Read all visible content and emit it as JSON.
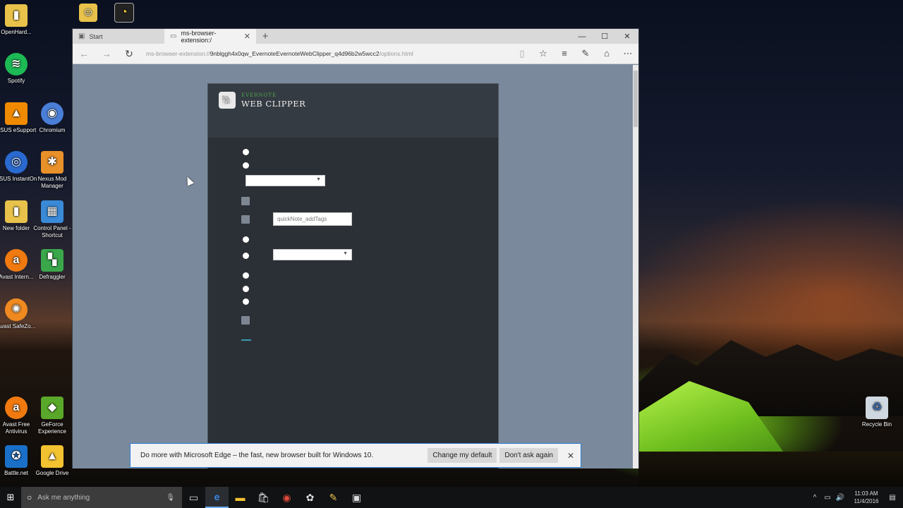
{
  "desktop": {
    "icons": [
      {
        "label": "OpenHard...",
        "icon": "folder-icon",
        "color": "#e8c24a"
      },
      {
        "label": "Spotify",
        "icon": "spotify-icon",
        "color": "#1db954"
      },
      {
        "label": "ASUS eSupport",
        "icon": "vlc-icon",
        "color": "#f08a00"
      },
      {
        "label": "Chromium",
        "icon": "chromium-icon",
        "color": "#4a7fd8"
      },
      {
        "label": "ASUS InstantOn",
        "icon": "asus-icon",
        "color": "#2a6ad0"
      },
      {
        "label": "Nexus Mod Manager",
        "icon": "nexus-icon",
        "color": "#e8902a"
      },
      {
        "label": "New folder",
        "icon": "folder-icon",
        "color": "#e8c24a"
      },
      {
        "label": "Control Panel - Shortcut",
        "icon": "control-panel-icon",
        "color": "#3a8ad8"
      },
      {
        "label": "Avast Intern...",
        "icon": "avast-icon",
        "color": "#f07a10"
      },
      {
        "label": "Defraggler",
        "icon": "defraggler-icon",
        "color": "#3aa84a"
      },
      {
        "label": "Avast SafeZo...",
        "icon": "avast-safezone-icon",
        "color": "#f08a20"
      },
      {
        "label": "Avast Free Antivirus",
        "icon": "avast-icon",
        "color": "#f07a10"
      },
      {
        "label": "GeForce Experience",
        "icon": "geforce-icon",
        "color": "#5aa82a"
      },
      {
        "label": "Battle.net",
        "icon": "battlenet-icon",
        "color": "#1a70c8"
      },
      {
        "label": "Google Drive",
        "icon": "google-drive-icon",
        "color": "#f2c230"
      },
      {
        "label": "Recycle Bin",
        "icon": "recycle-bin-icon",
        "color": "#cfd8e0"
      }
    ]
  },
  "browser": {
    "tabs": [
      {
        "label": "Start",
        "active": false
      },
      {
        "label": "ms-browser-extension:/",
        "active": true
      }
    ],
    "url_prefix": "ms-browser-extension://",
    "url_host": "9nblggh4x0qw_EvernoteEvernoteWebClipper_q4d96b2w5wcc2",
    "url_path": "/options.html"
  },
  "clipper": {
    "brand_small": "EVERNOTE",
    "brand_big": "WEB CLIPPER",
    "tags_placeholder": "quickNote_addTags"
  },
  "notification": {
    "message": "Do more with Microsoft Edge – the fast, new browser built for Windows 10.",
    "change_default": "Change my default",
    "dont_ask": "Don't ask again"
  },
  "taskbar": {
    "search_placeholder": "Ask me anything",
    "time": "11:03 AM",
    "date": "11/4/2016"
  }
}
